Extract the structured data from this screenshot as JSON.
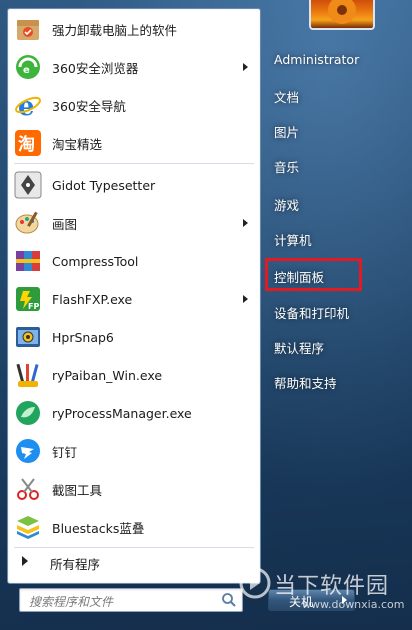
{
  "programs": [
    {
      "label": "强力卸载电脑上的软件",
      "icon": "uninstall-box-icon",
      "has_submenu": false
    },
    {
      "label": "360安全浏览器",
      "icon": "360-browser-icon",
      "has_submenu": true
    },
    {
      "label": "360安全导航",
      "icon": "ie-e-icon",
      "has_submenu": false
    },
    {
      "label": "淘宝精选",
      "icon": "taobao-icon",
      "has_submenu": false
    },
    {
      "label": "Gidot Typesetter",
      "icon": "pen-nib-icon",
      "has_submenu": false
    },
    {
      "label": "画图",
      "icon": "paint-palette-icon",
      "has_submenu": true
    },
    {
      "label": "CompressTool",
      "icon": "compress-books-icon",
      "has_submenu": false
    },
    {
      "label": "FlashFXP.exe",
      "icon": "flashfxp-icon",
      "has_submenu": true
    },
    {
      "label": "HprSnap6",
      "icon": "camera-icon",
      "has_submenu": false
    },
    {
      "label": "ryPaiban_Win.exe",
      "icon": "brushes-icon",
      "has_submenu": false
    },
    {
      "label": "ryProcessManager.exe",
      "icon": "leaf-globe-icon",
      "has_submenu": false
    },
    {
      "label": "钉钉",
      "icon": "dingtalk-icon",
      "has_submenu": false
    },
    {
      "label": "截图工具",
      "icon": "scissors-icon",
      "has_submenu": false
    },
    {
      "label": "Bluestacks蓝叠",
      "icon": "bluestacks-icon",
      "has_submenu": false
    }
  ],
  "all_programs_label": "所有程序",
  "search": {
    "placeholder": "搜索程序和文件"
  },
  "right_items": [
    {
      "label": "Administrator"
    },
    {
      "label": "文档"
    },
    {
      "label": "图片"
    },
    {
      "label": "音乐"
    },
    {
      "label": "游戏"
    },
    {
      "label": "计算机"
    },
    {
      "label": "控制面板"
    },
    {
      "label": "设备和打印机"
    },
    {
      "label": "默认程序"
    },
    {
      "label": "帮助和支持"
    }
  ],
  "shutdown_label": "关机",
  "watermark": {
    "text": "当下软件园",
    "url": "www.downxia.com"
  },
  "colors": {
    "highlight": "#e21b23",
    "accent": "#34577c"
  }
}
